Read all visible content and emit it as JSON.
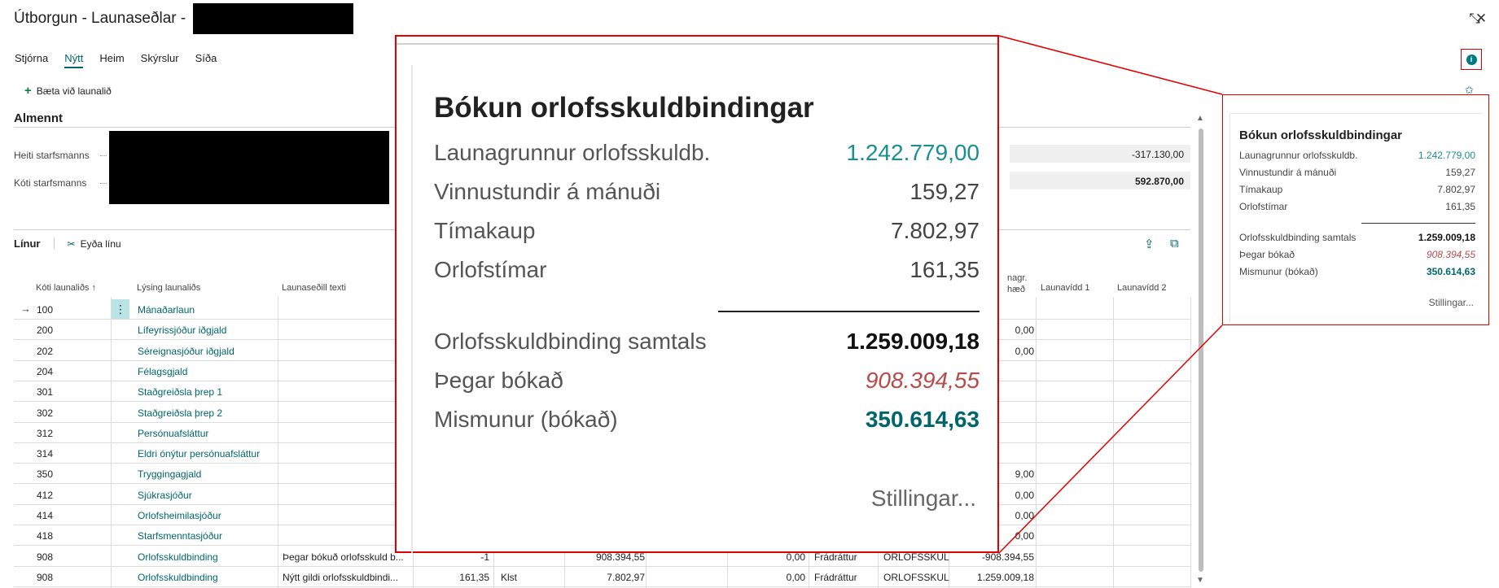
{
  "window": {
    "title": "Útborgun - Launaseðlar -",
    "collapse_icon": "collapse-icon",
    "close_icon": "close-icon"
  },
  "menu": {
    "items": [
      "Stjórna",
      "Nýtt",
      "Heim",
      "Skýrslur",
      "Síða"
    ],
    "active": "Nýtt"
  },
  "actions": {
    "add_line": "Bæta við launalið"
  },
  "general": {
    "title": "Almennt",
    "fields": [
      {
        "label": "Heiti starfsmanns",
        "value": "-317.130,00"
      },
      {
        "label": "Kóti starfsmanns",
        "value": "592.870,00"
      }
    ]
  },
  "lines": {
    "title": "Línur",
    "delete_line": "Eyða línu",
    "columns": [
      "Kóti launaliðs ↑",
      "Lýsing launaliðs",
      "Launaseðill texti",
      "nagr.",
      "hæð",
      "Launavídd 1",
      "Launavídd 2"
    ],
    "rows": [
      {
        "code": "100",
        "desc": "Mánaðarlaun",
        "text": "",
        "c1": "",
        "c2": "",
        "c3": "",
        "c4": "",
        "c5": "",
        "c6": "",
        "c7": "",
        "c8": ""
      },
      {
        "code": "200",
        "desc": "Lífeyrissjóður iðgjald",
        "c8": "0,00"
      },
      {
        "code": "202",
        "desc": "Séreignasjóður iðgjald",
        "c8": "0,00"
      },
      {
        "code": "204",
        "desc": "Félagsgjald",
        "c8": ""
      },
      {
        "code": "301",
        "desc": "Staðgreiðsla þrep 1",
        "c8": ""
      },
      {
        "code": "302",
        "desc": "Staðgreiðsla þrep 2",
        "c8": ""
      },
      {
        "code": "312",
        "desc": "Persónuafsláttur",
        "c8": ""
      },
      {
        "code": "314",
        "desc": "Eldri ónýtur persónuafsláttur",
        "c8": ""
      },
      {
        "code": "350",
        "desc": "Tryggingagjald",
        "c8": "9,00"
      },
      {
        "code": "412",
        "desc": "Sjúkrasjóður",
        "c8": "0,00"
      },
      {
        "code": "414",
        "desc": "Orlofsheimilasjóður",
        "c8": "0,00"
      },
      {
        "code": "418",
        "desc": "Starfsmenntasjóður",
        "c8": "0,00"
      },
      {
        "code": "908",
        "desc": "Orlofsskuldbinding",
        "text": "Þegar bókuð orlofsskuld b...",
        "c1": "-1",
        "c2": "",
        "c3": "908.394,55",
        "c5": "0,00",
        "c6": "Frádráttur",
        "c7": "ORLOFSSKUL",
        "c8": "-908.394,55"
      },
      {
        "code": "908",
        "desc": "Orlofsskuldbinding",
        "text": "Nýtt gildi orlofsskuldbindi...",
        "c1": "161,35",
        "c2": "Klst",
        "c3": "7.802,97",
        "c5": "0,00",
        "c6": "Frádráttur",
        "c7": "ORLOFSSKUL",
        "c8": "1.259.009,18"
      }
    ]
  },
  "factbox": {
    "title": "Bókun orlofsskuldbindingar",
    "rows": [
      {
        "label": "Launagrunnur orlofsskuldb.",
        "value": "1.242.779,00"
      },
      {
        "label": "Vinnustundir á mánuði",
        "value": "159,27"
      },
      {
        "label": "Tímakaup",
        "value": "7.802,97"
      },
      {
        "label": "Orlofstímar",
        "value": "161,35"
      },
      {
        "label": "Orlofsskuldbinding samtals",
        "value": "1.259.009,18"
      },
      {
        "label": "Þegar bókað",
        "value": "908.394,55"
      },
      {
        "label": "Mismunur (bókað)",
        "value": "350.614,63"
      }
    ],
    "settings": "Stillingar..."
  },
  "colors": {
    "accent": "#00666b",
    "link": "#1a8f92",
    "highlight_border": "#e00000",
    "negative": "#b84a4a"
  }
}
